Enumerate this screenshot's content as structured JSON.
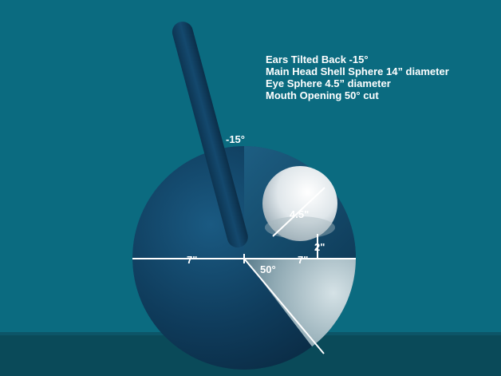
{
  "notes": [
    "Ears Tilted Back -15°",
    "Main Head Shell Sphere 14” diameter",
    "Eye Sphere 4.5” diameter",
    "Mouth Opening 50° cut"
  ],
  "dimensions": {
    "ear_angle": "-15°",
    "eye_diameter": "4.5\"",
    "eye_offset": "2\"",
    "left_radius": "7\"",
    "right_radius": "7\"",
    "mouth_angle": "50°"
  },
  "colors": {
    "background": "#0b6b80",
    "floor": "#0a4a59",
    "head_shell": "#0f3c5c",
    "eye": "#f4f4f4",
    "text": "#ffffff"
  }
}
